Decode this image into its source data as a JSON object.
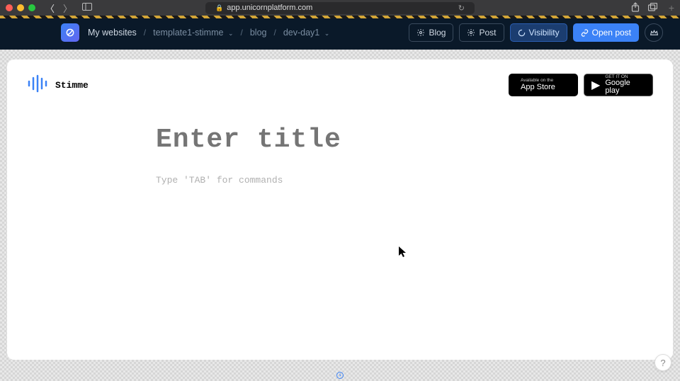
{
  "browser": {
    "url": "app.unicornplatform.com"
  },
  "breadcrumbs": {
    "home": "My websites",
    "site": "template1-stimme",
    "section": "blog",
    "post": "dev-day1"
  },
  "navbar_actions": {
    "blog": "Blog",
    "post": "Post",
    "visibility": "Visibility",
    "open_post": "Open post"
  },
  "site": {
    "name": "Stimme",
    "appstore_small": "Available on the",
    "appstore_big": "App Store",
    "google_small": "GET IT ON",
    "google_big": "Google play"
  },
  "editor": {
    "title_placeholder": "Enter title",
    "body_placeholder": "Type 'TAB' for commands"
  },
  "help": {
    "label": "?"
  }
}
